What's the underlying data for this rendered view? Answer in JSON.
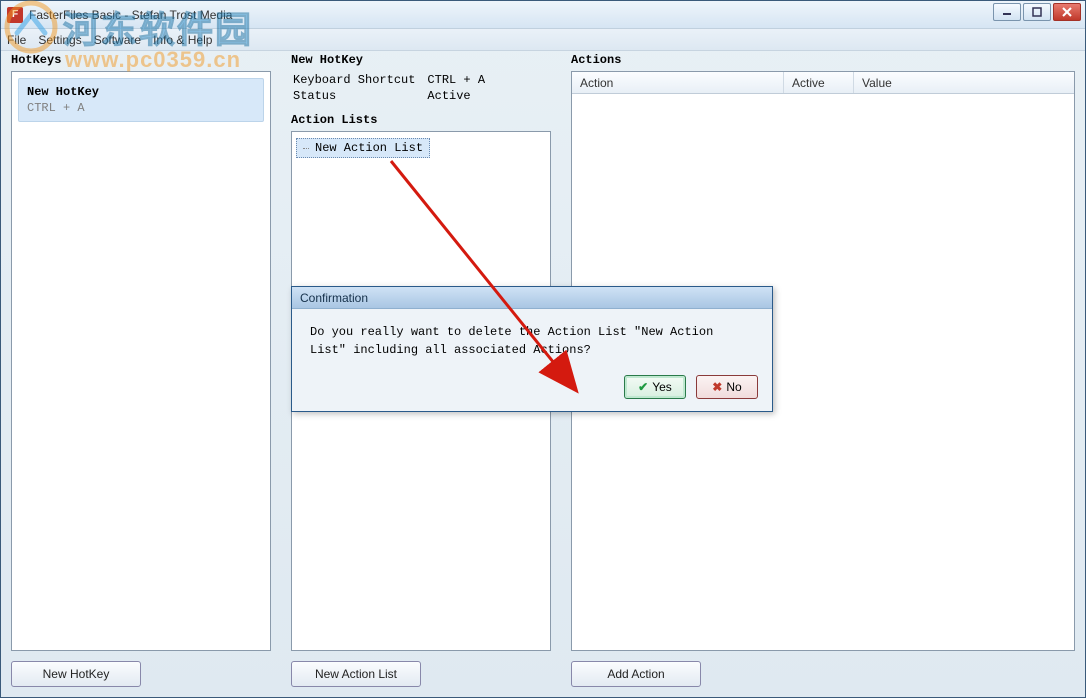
{
  "window": {
    "title": "FasterFiles Basic - Stefan Trost Media",
    "app_icon_letter": "F"
  },
  "menubar": {
    "file": "File",
    "settings": "Settings",
    "software": "Software",
    "info_help": "Info & Help"
  },
  "left_panel": {
    "title": "HotKeys",
    "item": {
      "name": "New HotKey",
      "shortcut": "CTRL + A"
    },
    "button": "New HotKey"
  },
  "mid_panel": {
    "detail_title": "New HotKey",
    "row1_label": "Keyboard Shortcut",
    "row1_value": "CTRL + A",
    "row2_label": "Status",
    "row2_value": "Active",
    "list_title": "Action Lists",
    "tree_item": "New Action List",
    "button": "New Action List"
  },
  "right_panel": {
    "title": "Actions",
    "col_action": "Action",
    "col_active": "Active",
    "col_value": "Value",
    "button": "Add Action"
  },
  "dialog": {
    "title": "Confirmation",
    "message": "Do you really want to delete the Action List \"New Action List\" including all associated Actions?",
    "yes_label": "Yes",
    "no_label": "No",
    "yes_icon": "✔",
    "no_icon": "✖"
  },
  "watermark": {
    "text_cn": "河东软件园",
    "url": "www.pc0359.cn"
  },
  "annotation": {
    "color": "#d41a0f"
  }
}
